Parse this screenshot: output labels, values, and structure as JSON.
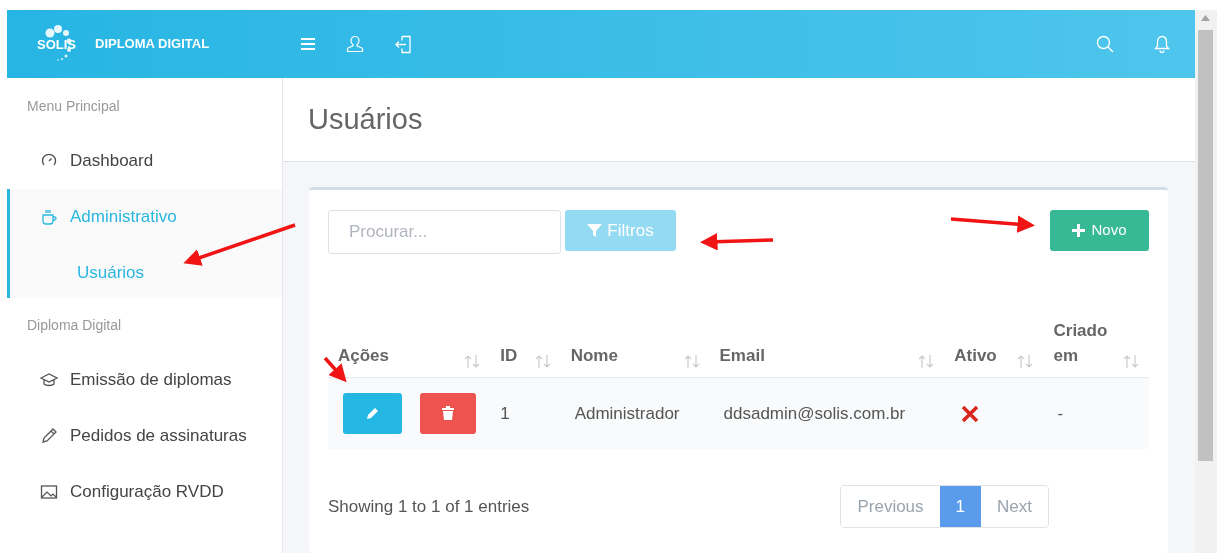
{
  "header": {
    "logo_text": "SOLIS",
    "app_title": "DIPLOMA DIGITAL"
  },
  "sidebar": {
    "sections": [
      {
        "title": "Menu Principal",
        "items": [
          {
            "kind": "dashboard",
            "label": "Dashboard",
            "selected": false
          },
          {
            "kind": "cup",
            "label": "Administrativo",
            "selected": true,
            "children": [
              {
                "label": "Usuários",
                "selected": true
              }
            ]
          }
        ]
      },
      {
        "title": "Diploma Digital",
        "items": [
          {
            "kind": "graduation",
            "label": "Emissão de diplomas",
            "selected": false
          },
          {
            "kind": "pencil",
            "label": "Pedidos de assinaturas",
            "selected": false
          },
          {
            "kind": "image",
            "label": "Configuração RVDD",
            "selected": false
          }
        ]
      }
    ]
  },
  "page_title": "Usuários",
  "toolbar": {
    "search": {
      "placeholder": "Procurar..."
    },
    "filter_button": "Filtros",
    "new_button": "Novo"
  },
  "table": {
    "columns": [
      "Ações",
      "ID",
      "Nome",
      "Email",
      "Ativo",
      "Criado em"
    ],
    "rows": [
      {
        "id": "1",
        "name": "Administrador",
        "email": "ddsadmin@solis.com.br",
        "active": false,
        "created": "-"
      }
    ]
  },
  "footer": {
    "info": "Showing 1 to 1 of 1 entries",
    "previous": {
      "label": "Previous",
      "disabled": true
    },
    "pages": [
      {
        "label": "1",
        "selected": true
      }
    ],
    "next": {
      "label": "Next",
      "disabled": true
    }
  }
}
